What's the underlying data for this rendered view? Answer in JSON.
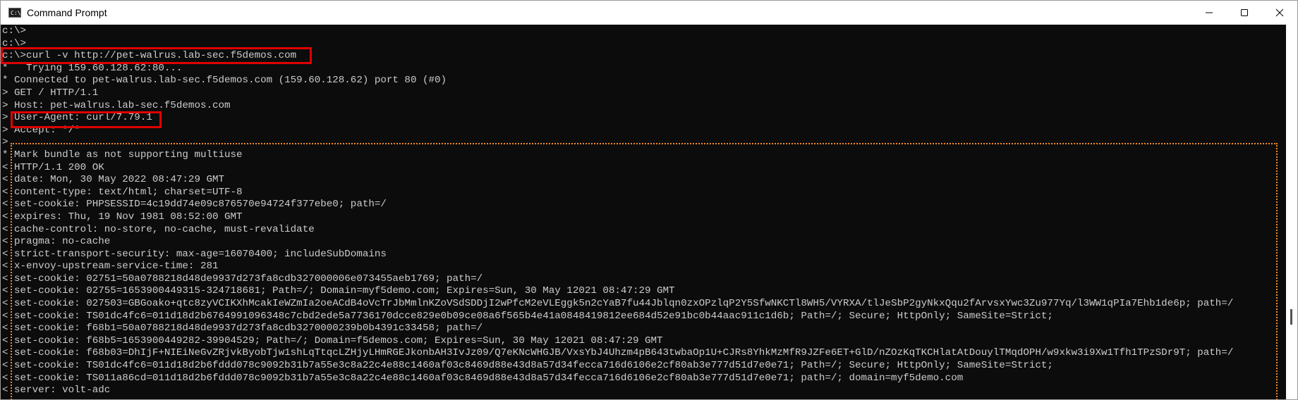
{
  "window": {
    "title": "Command Prompt",
    "icon": "cmd-icon",
    "icon_text": "C:\\"
  },
  "controls": [
    "minimize-icon",
    "maximize-icon",
    "close-icon"
  ],
  "console": {
    "lines": [
      "c:\\>",
      "c:\\>",
      "c:\\>curl -v http://pet-walrus.lab-sec.f5demos.com",
      "*   Trying 159.60.128.62:80...",
      "* Connected to pet-walrus.lab-sec.f5demos.com (159.60.128.62) port 80 (#0)",
      "> GET / HTTP/1.1",
      "> Host: pet-walrus.lab-sec.f5demos.com",
      "> User-Agent: curl/7.79.1",
      "> Accept: */*",
      ">",
      "* Mark bundle as not supporting multiuse",
      "< HTTP/1.1 200 OK",
      "< date: Mon, 30 May 2022 08:47:29 GMT",
      "< content-type: text/html; charset=UTF-8",
      "< set-cookie: PHPSESSID=4c19dd74e09c876570e94724f377ebe0; path=/",
      "< expires: Thu, 19 Nov 1981 08:52:00 GMT",
      "< cache-control: no-store, no-cache, must-revalidate",
      "< pragma: no-cache",
      "< strict-transport-security: max-age=16070400; includeSubDomains",
      "< x-envoy-upstream-service-time: 281",
      "< set-cookie: 02751=50a0788218d48de9937d273fa8cdb327000006e073455aeb1769; path=/",
      "< set-cookie: 02755=1653900449315-324718681; Path=/; Domain=myf5demo.com; Expires=Sun, 30 May 12021 08:47:29 GMT",
      "< set-cookie: 027503=GBGoako+qtc8zyVCIKXhMcakIeWZmIa2oeACdB4oVcTrJbMmlnKZoVSdSDDjI2wPfcM2eVLEggk5n2cYaB7fu44Jblqn0zxOPzlqP2Y5SfwNKCTl8WH5/VYRXA/tlJeSbP2gyNkxQqu2fArvsxYwc3Zu977Yq/l3WW1qPIa7Ehb1de6p; path=/",
      "< set-cookie: TS01dc4fc6=011d18d2b6764991096348c7cbd2ede5a7736170dcce829e0b09ce08a6f565b4e41a0848419812ee684d52e91bc0b44aac911c1d6b; Path=/; Secure; HttpOnly; SameSite=Strict;",
      "< set-cookie: f68b1=50a0788218d48de9937d273fa8cdb3270000239b0b4391c33458; path=/",
      "< set-cookie: f68b5=1653900449282-39904529; Path=/; Domain=f5demos.com; Expires=Sun, 30 May 12021 08:47:29 GMT",
      "< set-cookie: f68b03=DhIjF+NIEiNeGvZRjvkByobTjw1shLqTtqcLZHjyLHmRGEJkonbAH3IvJz09/Q7eKNcWHGJB/VxsYbJ4Uhzm4pB643twbaOp1U+CJRs8YhkMzMfR9JZFe6ET+GlD/nZOzKqTKCHlatAtDouylTMqdOPH/w9xkw3i9Xw1Tfh1TPzSDr9T; path=/",
      "< set-cookie: TS01dc4fc6=011d18d2b6fddd078c9092b31b7a55e3c8a22c4e88c1460af03c8469d88e43d8a57d34fecca716d6106e2cf80ab3e777d51d7e0e71; Path=/; Secure; HttpOnly; SameSite=Strict;",
      "< set-cookie: TS011a86cd=011d18d2b6fddd078c9092b31b7a55e3c8a22c4e88c1460af03c8469d88e43d8a57d34fecca716d6106e2cf80ab3e777d51d7e0e71; path=/; domain=myf5demo.com",
      "< server: volt-adc"
    ]
  },
  "highlight_colors": {
    "box": "#e00000",
    "dotted_frame": "#f08a30"
  }
}
